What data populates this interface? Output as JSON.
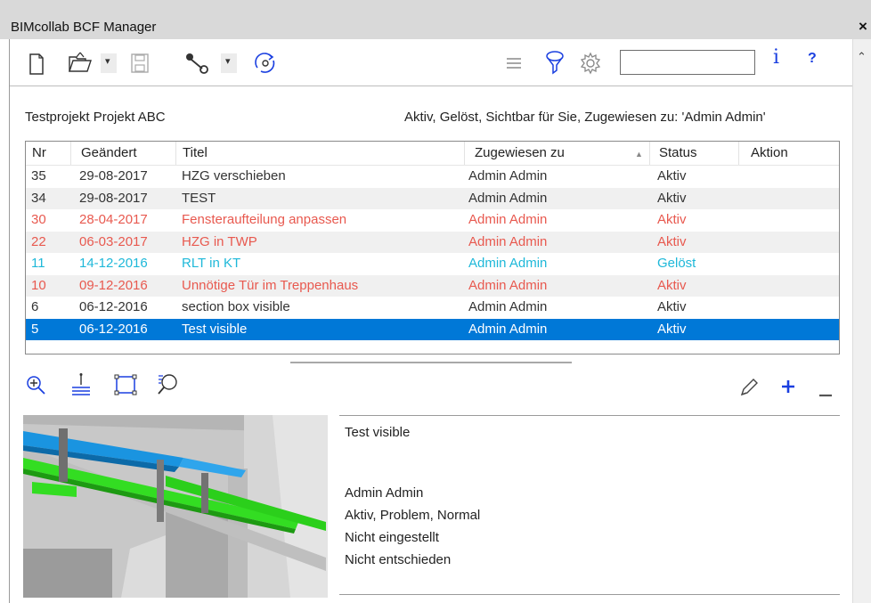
{
  "window": {
    "title": "BIMcollab BCF Manager",
    "close_glyph": "×"
  },
  "toolbar": {
    "icons": [
      "new-file-icon",
      "open-folder-icon",
      "dropdown-arrow-icon",
      "save-icon",
      "connect-icon",
      "dropdown-arrow-icon",
      "sync-icon",
      "list-icon",
      "filter-icon",
      "settings-icon"
    ],
    "search_value": "",
    "info_label": "i",
    "help_label": "?"
  },
  "project": {
    "name": "Testprojekt Projekt ABC",
    "filter_summary": "Aktiv, Gelöst, Sichtbar für Sie, Zugewiesen zu: 'Admin Admin'"
  },
  "table": {
    "columns": [
      "Nr",
      "Geändert",
      "Titel",
      "Zugewiesen zu",
      "Status",
      "Aktion"
    ],
    "sorted_column": "Zugewiesen zu",
    "rows": [
      {
        "nr": "35",
        "date": "29-08-2017",
        "title": "HZG verschieben",
        "assigned": "Admin Admin",
        "status": "Aktiv",
        "action": "",
        "color": "#333333"
      },
      {
        "nr": "34",
        "date": "29-08-2017",
        "title": "TEST",
        "assigned": "Admin Admin",
        "status": "Aktiv",
        "action": "",
        "color": "#333333"
      },
      {
        "nr": "30",
        "date": "28-04-2017",
        "title": "Fensteraufteilung anpassen",
        "assigned": "Admin Admin",
        "status": "Aktiv",
        "action": "",
        "color": "#e8594f"
      },
      {
        "nr": "22",
        "date": "06-03-2017",
        "title": "HZG in TWP",
        "assigned": "Admin Admin",
        "status": "Aktiv",
        "action": "",
        "color": "#e8594f"
      },
      {
        "nr": "11",
        "date": "14-12-2016",
        "title": "RLT in KT",
        "assigned": "Admin Admin",
        "status": "Gelöst",
        "action": "",
        "color": "#1eb8d9"
      },
      {
        "nr": "10",
        "date": "09-12-2016",
        "title": "Unnötige Tür im Treppenhaus",
        "assigned": "Admin Admin",
        "status": "Aktiv",
        "action": "",
        "color": "#e8594f"
      },
      {
        "nr": "6",
        "date": "06-12-2016",
        "title": "section box visible",
        "assigned": "Admin Admin",
        "status": "Aktiv",
        "action": "",
        "color": "#333333"
      },
      {
        "nr": "5",
        "date": "06-12-2016",
        "title": "Test visible",
        "assigned": "Admin Admin",
        "status": "Aktiv",
        "action": "",
        "color": "#ffffff"
      }
    ],
    "selected_row_color": "#0078d7"
  },
  "viewpoint_toolbar": {
    "icons": [
      "zoom-in-icon",
      "level-icon",
      "section-box-icon",
      "search-comments-icon",
      "edit-icon",
      "add-icon",
      "remove-icon"
    ]
  },
  "detail": {
    "title": "Test visible",
    "assigned": "Admin Admin",
    "status_type_priority": "Aktiv, Problem, Normal",
    "milestone": "Nicht eingestellt",
    "decision": "Nicht entschieden"
  }
}
